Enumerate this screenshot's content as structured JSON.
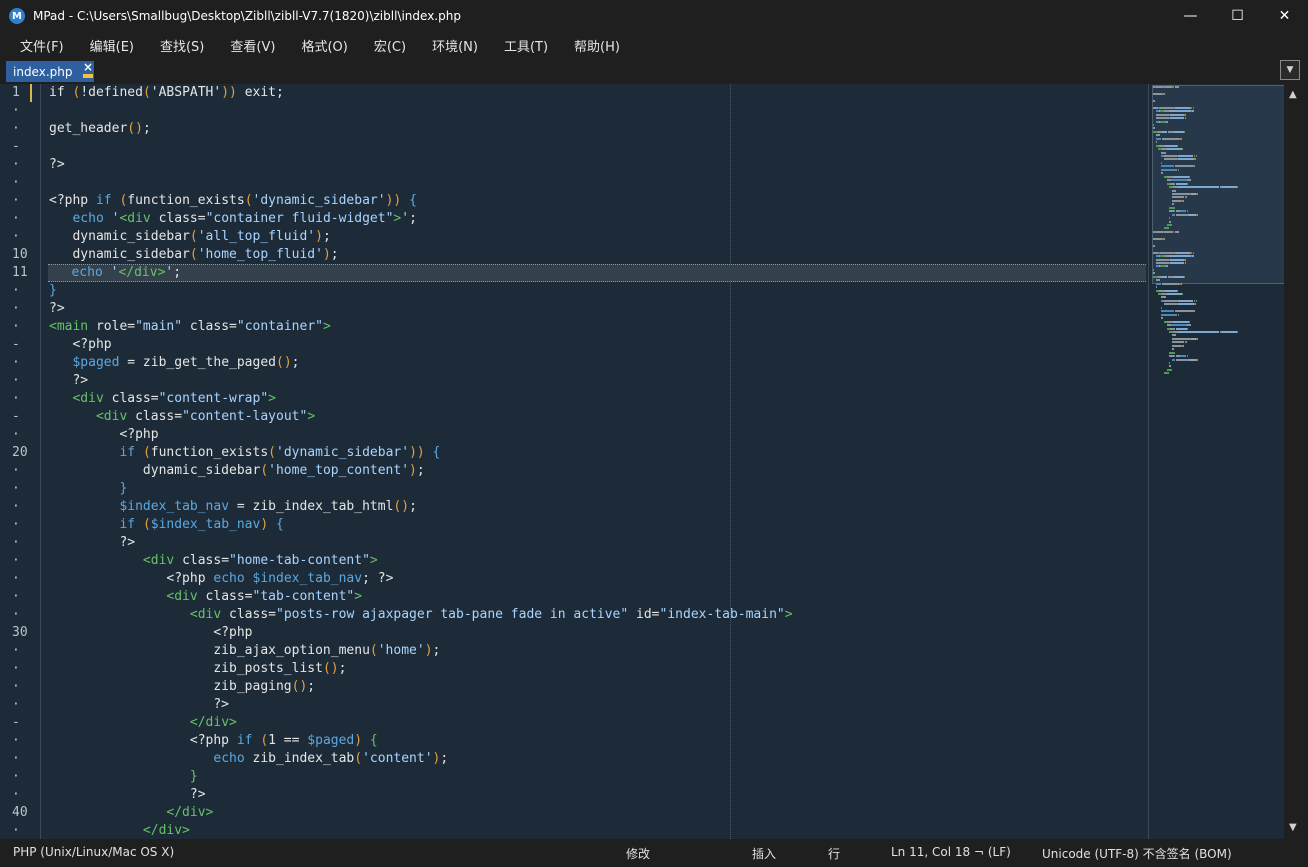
{
  "window": {
    "title": "MPad - C:\\Users\\Smallbug\\Desktop\\Zibll\\zibll-V7.7(1820)\\zibll\\index.php",
    "app_icon": "M",
    "minimize": "—",
    "maximize": "☐",
    "close": "✕"
  },
  "menu": [
    "文件(F)",
    "编辑(E)",
    "查找(S)",
    "查看(V)",
    "格式(O)",
    "宏(C)",
    "环境(N)",
    "工具(T)",
    "帮助(H)"
  ],
  "tab": {
    "label": "index.php",
    "close": "×",
    "dropdown": "▼"
  },
  "gutter": [
    "1",
    "·",
    "·",
    "-",
    "·",
    "·",
    "·",
    "·",
    "·",
    "10",
    "11",
    "·",
    "·",
    "·",
    "-",
    "·",
    "·",
    "·",
    "-",
    "·",
    "20",
    "·",
    "·",
    "·",
    "·",
    "·",
    "·",
    "·",
    "·",
    "·",
    "30",
    "·",
    "·",
    "·",
    "·",
    "-",
    "·",
    "·",
    "·",
    "·",
    "40",
    "·"
  ],
  "colors": {
    "keyword": "#5ba8e0",
    "string": "#a8d4ff",
    "tag": "#66c266",
    "paren": "#e3a23d",
    "text": "#e5e5e5",
    "background": "#1d2b38"
  },
  "code": [
    [
      [
        "p",
        "if "
      ],
      [
        "y",
        "("
      ],
      [
        "p",
        "!defined"
      ],
      [
        "y",
        "("
      ],
      [
        "p",
        "'ABSPATH'"
      ],
      [
        "y",
        "))"
      ],
      [
        "p",
        " exit;"
      ]
    ],
    [],
    [
      [
        "p",
        "get_header"
      ],
      [
        "y",
        "()"
      ],
      [
        "p",
        ";"
      ]
    ],
    [],
    [
      [
        "p",
        "?>"
      ]
    ],
    [],
    [
      [
        "p",
        "<?php "
      ],
      [
        "k",
        "if "
      ],
      [
        "y",
        "("
      ],
      [
        "p",
        "function_exists"
      ],
      [
        "y",
        "("
      ],
      [
        "s",
        "'dynamic_sidebar'"
      ],
      [
        "y",
        "))"
      ],
      [
        "p",
        " "
      ],
      [
        "b",
        "{"
      ]
    ],
    [
      [
        "p",
        "   "
      ],
      [
        "k",
        "echo "
      ],
      [
        "s",
        "'"
      ],
      [
        "t",
        "<div "
      ],
      [
        "p",
        "class="
      ],
      [
        "s",
        "\"container fluid-widget\""
      ],
      [
        "t",
        ">"
      ],
      [
        "s",
        "'"
      ],
      [
        "p",
        ";"
      ]
    ],
    [
      [
        "p",
        "   dynamic_sidebar"
      ],
      [
        "y",
        "("
      ],
      [
        "s",
        "'all_top_fluid'"
      ],
      [
        "y",
        ")"
      ],
      [
        "p",
        ";"
      ]
    ],
    [
      [
        "p",
        "   dynamic_sidebar"
      ],
      [
        "y",
        "("
      ],
      [
        "s",
        "'home_top_fluid'"
      ],
      [
        "y",
        ")"
      ],
      [
        "p",
        ";"
      ]
    ],
    [
      [
        "p",
        "   "
      ],
      [
        "k",
        "echo "
      ],
      [
        "s",
        "'"
      ],
      [
        "t",
        "</div>"
      ],
      [
        "s",
        "'"
      ],
      [
        "p",
        ";"
      ]
    ],
    [
      [
        "b",
        "}"
      ]
    ],
    [
      [
        "p",
        "?>"
      ]
    ],
    [
      [
        "t",
        "<main "
      ],
      [
        "p",
        "role="
      ],
      [
        "s",
        "\"main\""
      ],
      [
        "p",
        " class="
      ],
      [
        "s",
        "\"container\""
      ],
      [
        "t",
        ">"
      ]
    ],
    [
      [
        "p",
        "   <?php"
      ]
    ],
    [
      [
        "p",
        "   "
      ],
      [
        "k",
        "$paged"
      ],
      [
        "p",
        " = zib_get_the_paged"
      ],
      [
        "y",
        "()"
      ],
      [
        "p",
        ";"
      ]
    ],
    [
      [
        "p",
        "   ?>"
      ]
    ],
    [
      [
        "p",
        "   "
      ],
      [
        "t",
        "<div "
      ],
      [
        "p",
        "class="
      ],
      [
        "s",
        "\"content-wrap\""
      ],
      [
        "t",
        ">"
      ]
    ],
    [
      [
        "p",
        "      "
      ],
      [
        "t",
        "<div "
      ],
      [
        "p",
        "class="
      ],
      [
        "s",
        "\"content-layout\""
      ],
      [
        "t",
        ">"
      ]
    ],
    [
      [
        "p",
        "         <?php"
      ]
    ],
    [
      [
        "p",
        "         "
      ],
      [
        "k",
        "if "
      ],
      [
        "y",
        "("
      ],
      [
        "p",
        "function_exists"
      ],
      [
        "y",
        "("
      ],
      [
        "s",
        "'dynamic_sidebar'"
      ],
      [
        "y",
        "))"
      ],
      [
        "p",
        " "
      ],
      [
        "b",
        "{"
      ]
    ],
    [
      [
        "p",
        "            dynamic_sidebar"
      ],
      [
        "y",
        "("
      ],
      [
        "s",
        "'home_top_content'"
      ],
      [
        "y",
        ")"
      ],
      [
        "p",
        ";"
      ]
    ],
    [
      [
        "p",
        "         "
      ],
      [
        "b",
        "}"
      ]
    ],
    [
      [
        "p",
        "         "
      ],
      [
        "k",
        "$index_tab_nav"
      ],
      [
        "p",
        " = zib_index_tab_html"
      ],
      [
        "y",
        "()"
      ],
      [
        "p",
        ";"
      ]
    ],
    [
      [
        "p",
        "         "
      ],
      [
        "k",
        "if "
      ],
      [
        "y",
        "("
      ],
      [
        "k",
        "$index_tab_nav"
      ],
      [
        "y",
        ")"
      ],
      [
        "p",
        " "
      ],
      [
        "b",
        "{"
      ]
    ],
    [
      [
        "p",
        "         ?>"
      ]
    ],
    [
      [
        "p",
        "            "
      ],
      [
        "t",
        "<div "
      ],
      [
        "p",
        "class="
      ],
      [
        "s",
        "\"home-tab-content\""
      ],
      [
        "t",
        ">"
      ]
    ],
    [
      [
        "p",
        "               <?php "
      ],
      [
        "k",
        "echo "
      ],
      [
        "k",
        "$index_tab_nav"
      ],
      [
        "p",
        "; ?>"
      ]
    ],
    [
      [
        "p",
        "               "
      ],
      [
        "t",
        "<div "
      ],
      [
        "p",
        "class="
      ],
      [
        "s",
        "\"tab-content\""
      ],
      [
        "t",
        ">"
      ]
    ],
    [
      [
        "p",
        "                  "
      ],
      [
        "t",
        "<div "
      ],
      [
        "p",
        "class="
      ],
      [
        "s",
        "\"posts-row ajaxpager tab-pane fade in active\""
      ],
      [
        "p",
        " id="
      ],
      [
        "s",
        "\"index-tab-main\""
      ],
      [
        "t",
        ">"
      ]
    ],
    [
      [
        "p",
        "                     <?php"
      ]
    ],
    [
      [
        "p",
        "                     zib_ajax_option_menu"
      ],
      [
        "y",
        "("
      ],
      [
        "s",
        "'home'"
      ],
      [
        "y",
        ")"
      ],
      [
        "p",
        ";"
      ]
    ],
    [
      [
        "p",
        "                     zib_posts_list"
      ],
      [
        "y",
        "()"
      ],
      [
        "p",
        ";"
      ]
    ],
    [
      [
        "p",
        "                     zib_paging"
      ],
      [
        "y",
        "()"
      ],
      [
        "p",
        ";"
      ]
    ],
    [
      [
        "p",
        "                     ?>"
      ]
    ],
    [
      [
        "p",
        "                  "
      ],
      [
        "t",
        "</div>"
      ]
    ],
    [
      [
        "p",
        "                  <?php "
      ],
      [
        "k",
        "if "
      ],
      [
        "y",
        "("
      ],
      [
        "p",
        "1 == "
      ],
      [
        "k",
        "$paged"
      ],
      [
        "y",
        ")"
      ],
      [
        "p",
        " "
      ],
      [
        "g",
        "{"
      ]
    ],
    [
      [
        "p",
        "                     "
      ],
      [
        "k",
        "echo "
      ],
      [
        "p",
        "zib_index_tab"
      ],
      [
        "y",
        "("
      ],
      [
        "s",
        "'content'"
      ],
      [
        "y",
        ")"
      ],
      [
        "p",
        ";"
      ]
    ],
    [
      [
        "p",
        "                  "
      ],
      [
        "g",
        "}"
      ]
    ],
    [
      [
        "p",
        "                  ?>"
      ]
    ],
    [
      [
        "p",
        "               "
      ],
      [
        "t",
        "</div>"
      ]
    ],
    [
      [
        "p",
        "            "
      ],
      [
        "t",
        "</div>"
      ]
    ]
  ],
  "current_line_index": 10,
  "status": {
    "file_type": "PHP (Unix/Linux/Mac OS X)",
    "modified": "修改",
    "insert": "插入",
    "line_mode": "行",
    "position": "Ln 11, Col 18 ¬ (LF)",
    "encoding": "Unicode (UTF-8) 不含签名 (BOM)"
  }
}
